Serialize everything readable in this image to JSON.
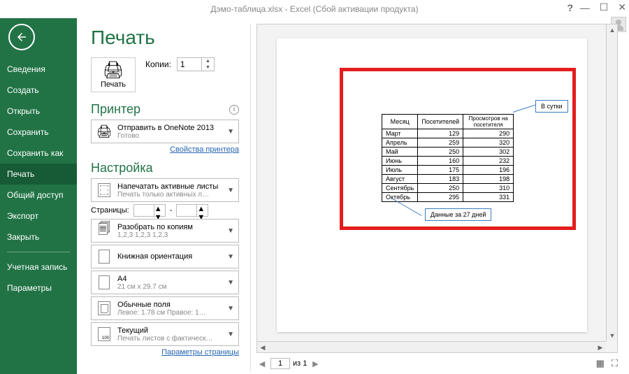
{
  "window": {
    "title": "Дэмо-таблица.xlsx - Excel (Сбой активации продукта)"
  },
  "sidebar": {
    "items": [
      {
        "label": "Сведения"
      },
      {
        "label": "Создать"
      },
      {
        "label": "Открыть"
      },
      {
        "label": "Сохранить"
      },
      {
        "label": "Сохранить как"
      },
      {
        "label": "Печать",
        "selected": true
      },
      {
        "label": "Общий доступ"
      },
      {
        "label": "Экспорт"
      },
      {
        "label": "Закрыть"
      }
    ],
    "footerItems": [
      {
        "label": "Учетная запись"
      },
      {
        "label": "Параметры"
      }
    ]
  },
  "page": {
    "title": "Печать"
  },
  "print": {
    "buttonLabel": "Печать",
    "copiesLabel": "Копии:",
    "copies": "1"
  },
  "printer": {
    "section": "Принтер",
    "name": "Отправить в OneNote 2013",
    "status": "Готово",
    "propsLink": "Свойства принтера"
  },
  "settings": {
    "section": "Настройка",
    "what": {
      "line1": "Напечатать активные листы",
      "line2": "Печать только активных л…"
    },
    "pagesLabel": "Страницы:",
    "pagesFrom": "",
    "pagesTo": "",
    "dash": "-",
    "collate": {
      "line1": "Разобрать по копиям",
      "line2": "1,2,3   1,2,3   1,2,3"
    },
    "orientation": {
      "line1": "Книжная ориентация",
      "line2": ""
    },
    "paper": {
      "line1": "A4",
      "line2": "21 см x 29.7 см"
    },
    "margins": {
      "line1": "Обычные поля",
      "line2": "Левое:  1.78 см  Правое: 1…"
    },
    "scaling": {
      "line1": "Текущий",
      "line2": "Печать листов с фактическ…",
      "badge": "100"
    },
    "pageSetupLink": "Параметры страницы"
  },
  "preview": {
    "pager": {
      "current": "1",
      "of": "из 1"
    },
    "callouts": {
      "top": "В сутки",
      "bottom": "Данные за 27 дней"
    },
    "tableHeaders": [
      "Месяц",
      "Посетителей",
      "Просмотров на посетителя"
    ],
    "rows": [
      [
        "Март",
        "129",
        "290"
      ],
      [
        "Апрель",
        "259",
        "320"
      ],
      [
        "Май",
        "250",
        "302"
      ],
      [
        "Июнь",
        "160",
        "232"
      ],
      [
        "Июль",
        "175",
        "196"
      ],
      [
        "Август",
        "183",
        "198"
      ],
      [
        "Сентябрь",
        "250",
        "310"
      ],
      [
        "Октябрь",
        "295",
        "331"
      ]
    ]
  }
}
